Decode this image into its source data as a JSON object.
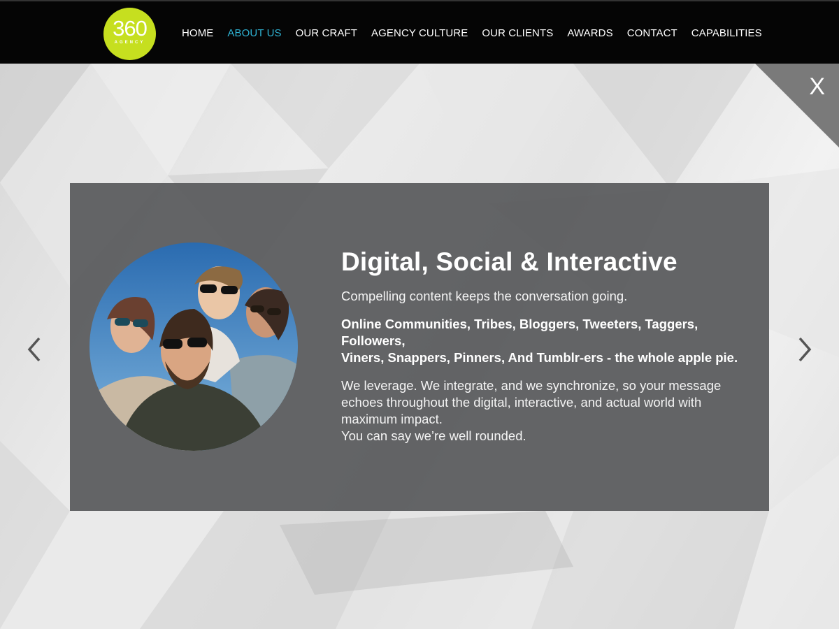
{
  "header": {
    "logo": {
      "number": "360",
      "subtitle": "AGENCY",
      "color": "#c6df1f"
    },
    "nav": [
      {
        "label": "HOME",
        "active": false
      },
      {
        "label": "ABOUT US",
        "active": true
      },
      {
        "label": "OUR CRAFT",
        "active": false
      },
      {
        "label": "AGENCY CULTURE",
        "active": false
      },
      {
        "label": "OUR CLIENTS",
        "active": false
      },
      {
        "label": "AWARDS",
        "active": false
      },
      {
        "label": "CONTACT",
        "active": false
      },
      {
        "label": "CAPABILITIES",
        "active": false
      }
    ],
    "active_color": "#2fb3d4"
  },
  "overlay": {
    "close_label": "X",
    "prev_icon": "chevron-left-icon",
    "next_icon": "chevron-right-icon"
  },
  "panel": {
    "title": "Digital, Social & Interactive",
    "lead": "Compelling content keeps the conversation going.",
    "bold_lines": [
      "Online Communities, Tribes, Bloggers, Tweeters, Taggers,",
      "Followers,",
      "Viners, Snappers, Pinners, And Tumblr-ers - the whole apple pie."
    ],
    "body_lines": [
      "We leverage. We integrate, and we synchronize, so your message",
      "echoes throughout the digital, interactive, and actual world with",
      "maximum impact.",
      "You can say we’re well rounded."
    ]
  }
}
